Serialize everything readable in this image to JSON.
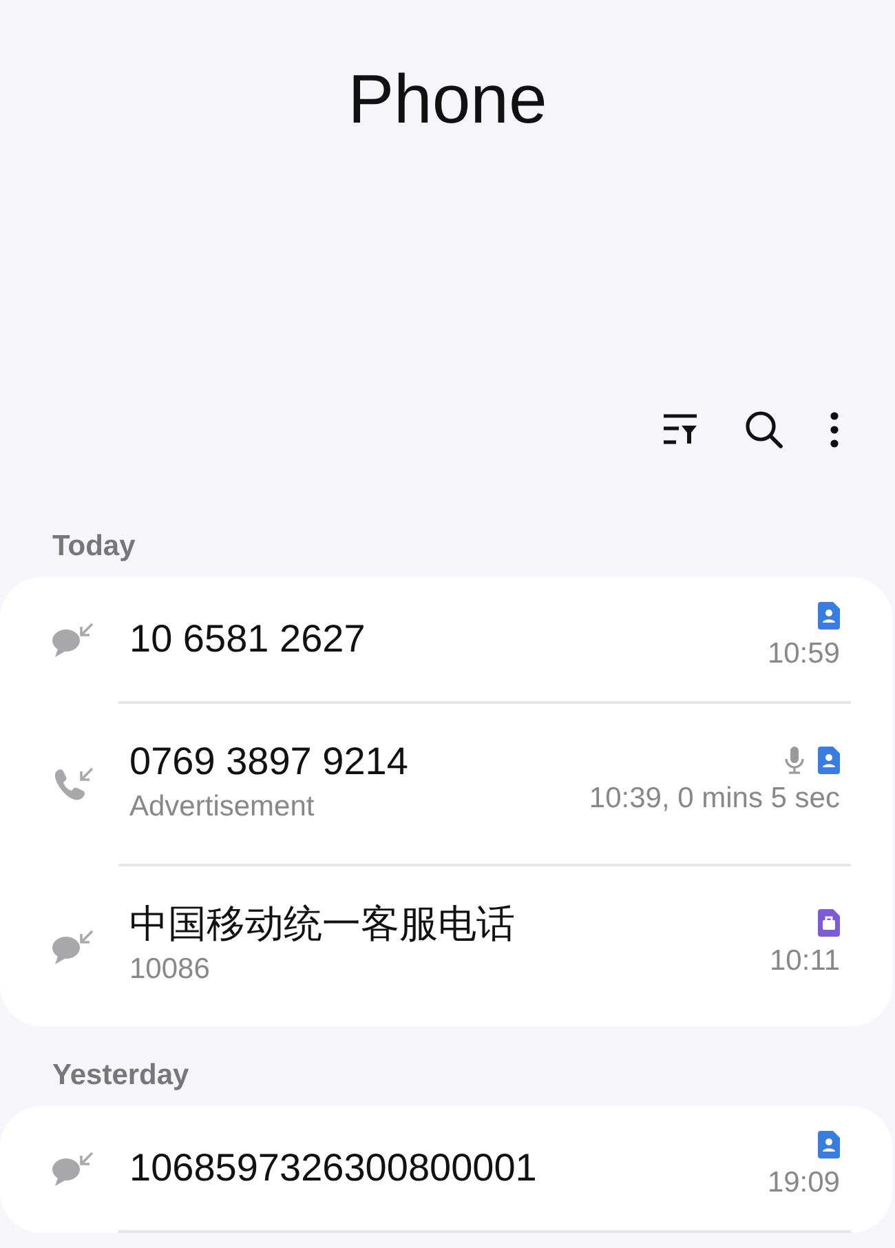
{
  "title": "Phone",
  "toolbar": [
    {
      "kind": "filter"
    },
    {
      "kind": "search"
    },
    {
      "kind": "more"
    }
  ],
  "sections": [
    {
      "header": "Today",
      "calls": [
        {
          "kind": "message",
          "number": "10 6581 2627",
          "badges": [
            {
              "kind": "contact"
            }
          ],
          "time": "10:59"
        },
        {
          "kind": "call",
          "number": "0769 3897 9214",
          "subtitle": "Advertisement",
          "badges": [
            {
              "kind": "recording"
            },
            {
              "kind": "contact"
            }
          ],
          "time": "10:39, 0 mins 5 sec"
        },
        {
          "kind": "message",
          "number": "中国移动统一客服电话",
          "subtitle": "10086",
          "badges": [
            {
              "kind": "work"
            }
          ],
          "time": "10:11"
        }
      ]
    },
    {
      "header": "Yesterday",
      "calls": [
        {
          "kind": "message",
          "number": "1068597326300800001",
          "badges": [
            {
              "kind": "contact"
            }
          ],
          "time": "19:09"
        }
      ]
    }
  ]
}
